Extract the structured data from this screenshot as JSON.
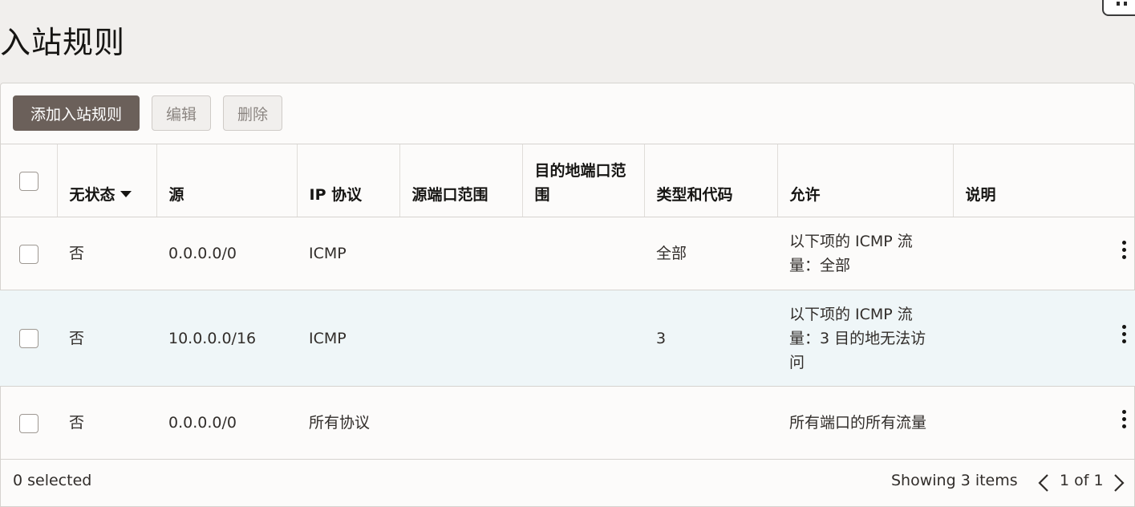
{
  "page": {
    "title": "入站规则"
  },
  "toolbar": {
    "add_label": "添加入站规则",
    "edit_label": "编辑",
    "delete_label": "删除"
  },
  "table": {
    "headers": {
      "stateless": "无状态",
      "source": "源",
      "protocol": "IP 协议",
      "source_port": "源端口范围",
      "dest_port": "目的地端口范围",
      "type_code": "类型和代码",
      "allows": "允许",
      "description": "说明"
    },
    "rows": [
      {
        "stateless": "否",
        "source": "0.0.0.0/0",
        "protocol": "ICMP",
        "source_port": "",
        "dest_port": "",
        "type_code": "全部",
        "allows": "以下项的 ICMP 流量：全部",
        "description": ""
      },
      {
        "stateless": "否",
        "source": "10.0.0.0/16",
        "protocol": "ICMP",
        "source_port": "",
        "dest_port": "",
        "type_code": "3",
        "allows": "以下项的 ICMP 流量：3 目的地无法访问",
        "description": ""
      },
      {
        "stateless": "否",
        "source": "0.0.0.0/0",
        "protocol": "所有协议",
        "source_port": "",
        "dest_port": "",
        "type_code": "",
        "allows": "所有端口的所有流量",
        "description": ""
      }
    ]
  },
  "footer": {
    "selected": "0 selected",
    "showing": "Showing 3 items",
    "page": "1 of 1"
  },
  "colors": {
    "page_bg": "#f1efed",
    "primary_button": "#6b605a",
    "highlight_row": "#eff6f8"
  }
}
